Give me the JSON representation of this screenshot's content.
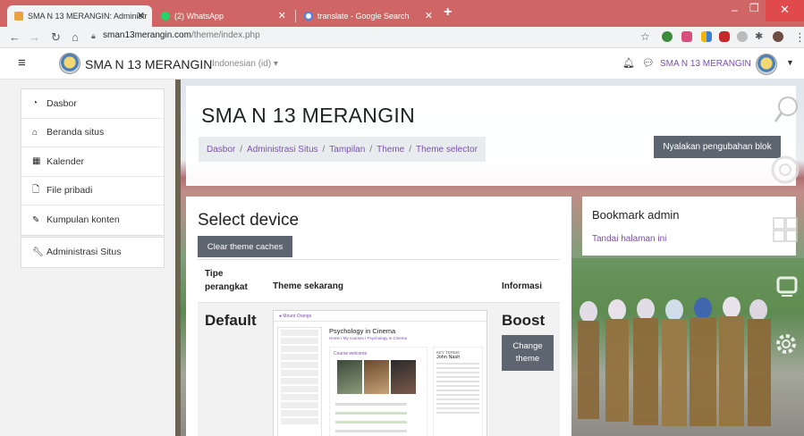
{
  "browser": {
    "tabs": [
      {
        "label": "SMA N 13 MERANGIN: Administr",
        "active": true,
        "favicon_color": "#e8a33c"
      },
      {
        "label": "(2) WhatsApp",
        "active": false,
        "favicon_color": "#25d366"
      },
      {
        "label": "translate - Google Search",
        "active": false,
        "favicon_color": "#4285f4"
      }
    ],
    "url_host": "sman13merangin.com",
    "url_path": "/theme/index.php",
    "window_controls": [
      "minimize-icon",
      "maximize-icon",
      "close-icon"
    ]
  },
  "navbar": {
    "site_name": "SMA N 13 MERANGIN",
    "language": "Indonesian (id) ▾",
    "user_name": "SMA N 13 MERANGIN"
  },
  "drawer": {
    "group1": [
      {
        "label": "Dasbor",
        "icon": "tachometer-icon"
      },
      {
        "label": "Beranda situs",
        "icon": "home-icon"
      },
      {
        "label": "Kalender",
        "icon": "calendar-icon"
      },
      {
        "label": "File pribadi",
        "icon": "file-icon"
      },
      {
        "label": "Kumpulan konten",
        "icon": "paint-brush-icon"
      }
    ],
    "group2": [
      {
        "label": "Administrasi Situs",
        "icon": "wrench-icon"
      }
    ]
  },
  "header": {
    "title": "SMA N 13 MERANGIN",
    "breadcrumb": [
      "Dasbor",
      "Administrasi Situs",
      "Tampilan",
      "Theme",
      "Theme selector"
    ],
    "edit_button": "Nyalakan pengubahan blok"
  },
  "device": {
    "title": "Select device",
    "clear_button": "Clear theme caches",
    "columns": [
      "Tipe perangkat",
      "Theme sekarang",
      "Informasi"
    ],
    "row": {
      "device_type": "Default",
      "theme": "Boost",
      "change_button": "Change theme"
    },
    "thumbnail": {
      "course_title": "Psychology in Cinema",
      "section": "Course welcome",
      "teacher_name": "John Nash"
    }
  },
  "bookmark": {
    "title": "Bookmark admin",
    "link": "Tandai halaman ini"
  }
}
